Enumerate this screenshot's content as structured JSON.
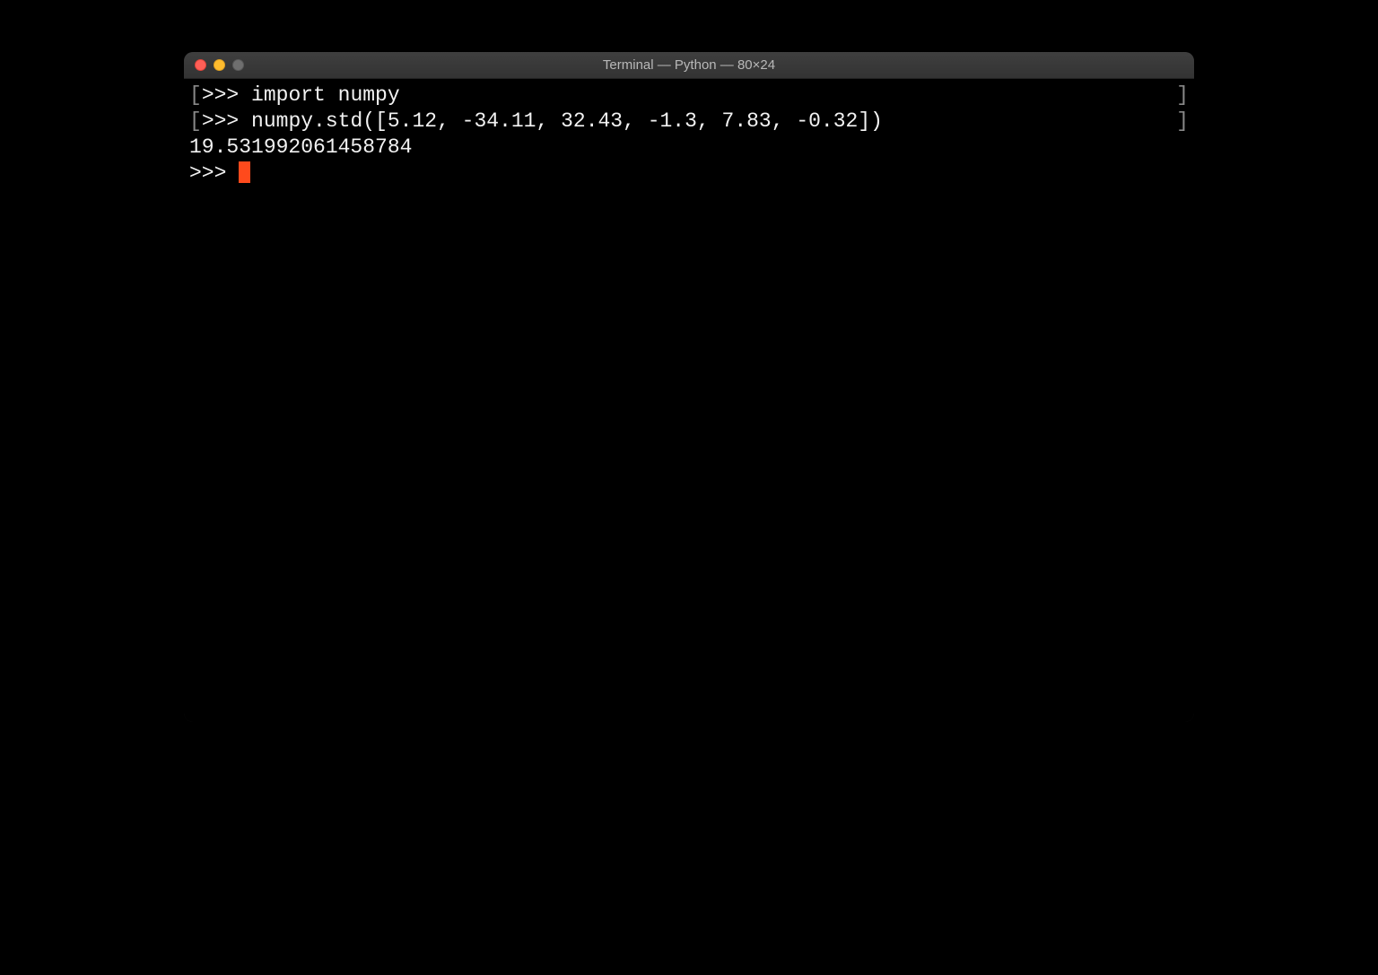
{
  "window": {
    "title": "Terminal — Python — 80×24"
  },
  "terminal": {
    "lines": [
      {
        "left_bracket": "[",
        "prompt": ">>> ",
        "content": "import numpy",
        "right_bracket": "]"
      },
      {
        "left_bracket": "[",
        "prompt": ">>> ",
        "content": "numpy.std([5.12, -34.11, 32.43, -1.3, 7.83, -0.32])",
        "right_bracket": "]"
      },
      {
        "left_bracket": "",
        "prompt": "",
        "content": "19.531992061458784",
        "right_bracket": ""
      },
      {
        "left_bracket": "",
        "prompt": ">>> ",
        "content": "",
        "right_bracket": "",
        "cursor": true
      }
    ]
  }
}
